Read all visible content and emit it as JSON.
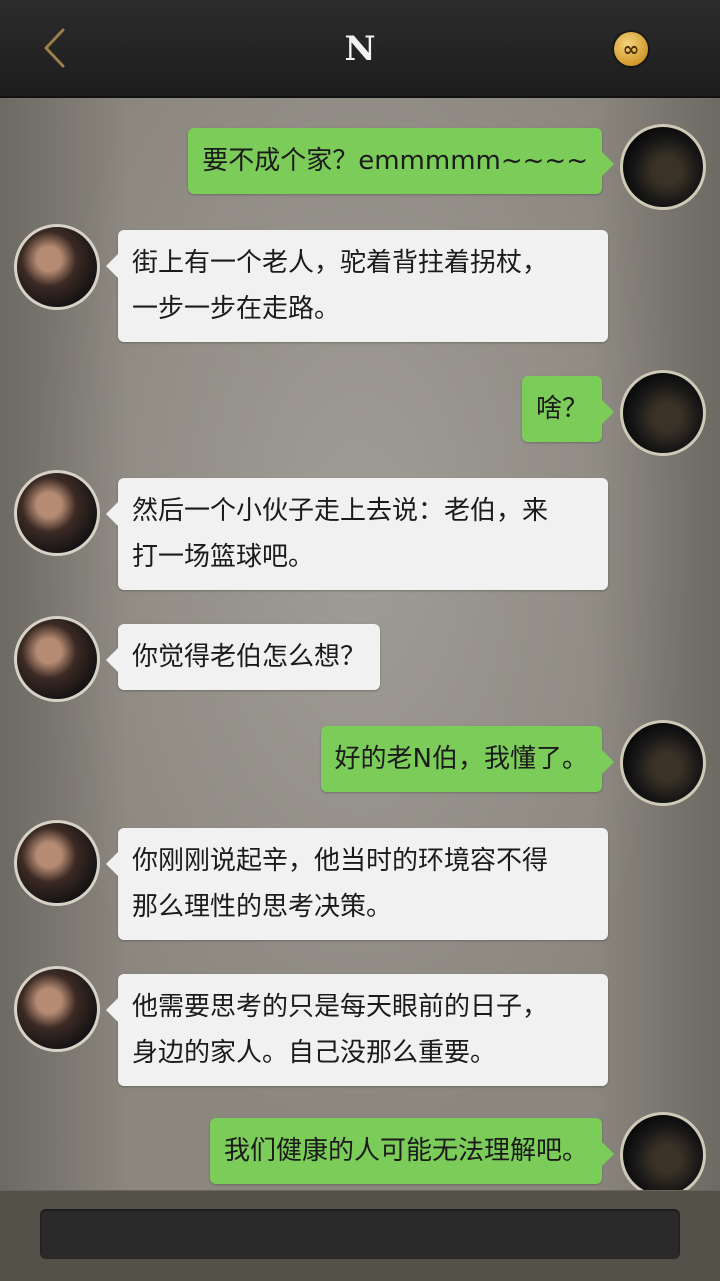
{
  "header": {
    "title": "N",
    "back_icon": "chevron-left-icon",
    "badge_icon": "infinity-badge-icon",
    "badge_glyph": "∞"
  },
  "messages": [
    {
      "sender": "me",
      "text": "要不成个家？emmmmm~~~~"
    },
    {
      "sender": "other",
      "text": "街上有一个老人，驼着背拄着拐杖，\n一步一步在走路。"
    },
    {
      "sender": "me",
      "text": "啥？"
    },
    {
      "sender": "other",
      "text": "然后一个小伙子走上去说：老伯，来\n打一场篮球吧。"
    },
    {
      "sender": "other",
      "text": "你觉得老伯怎么想？"
    },
    {
      "sender": "me",
      "text": "好的老N伯，我懂了。"
    },
    {
      "sender": "other",
      "text": "你刚刚说起辛，他当时的环境容不得\n那么理性的思考决策。"
    },
    {
      "sender": "other",
      "text": "他需要思考的只是每天眼前的日子，\n身边的家人。自己没那么重要。"
    },
    {
      "sender": "me",
      "text": "我们健康的人可能无法理解吧。"
    }
  ],
  "input": {
    "value": ""
  },
  "colors": {
    "header_bg": "#1d1d1d",
    "back_icon": "#9b7e4b",
    "me_bubble": "#7ccc59",
    "other_bubble": "#f1f1f1",
    "badge": "#d29a2e"
  }
}
